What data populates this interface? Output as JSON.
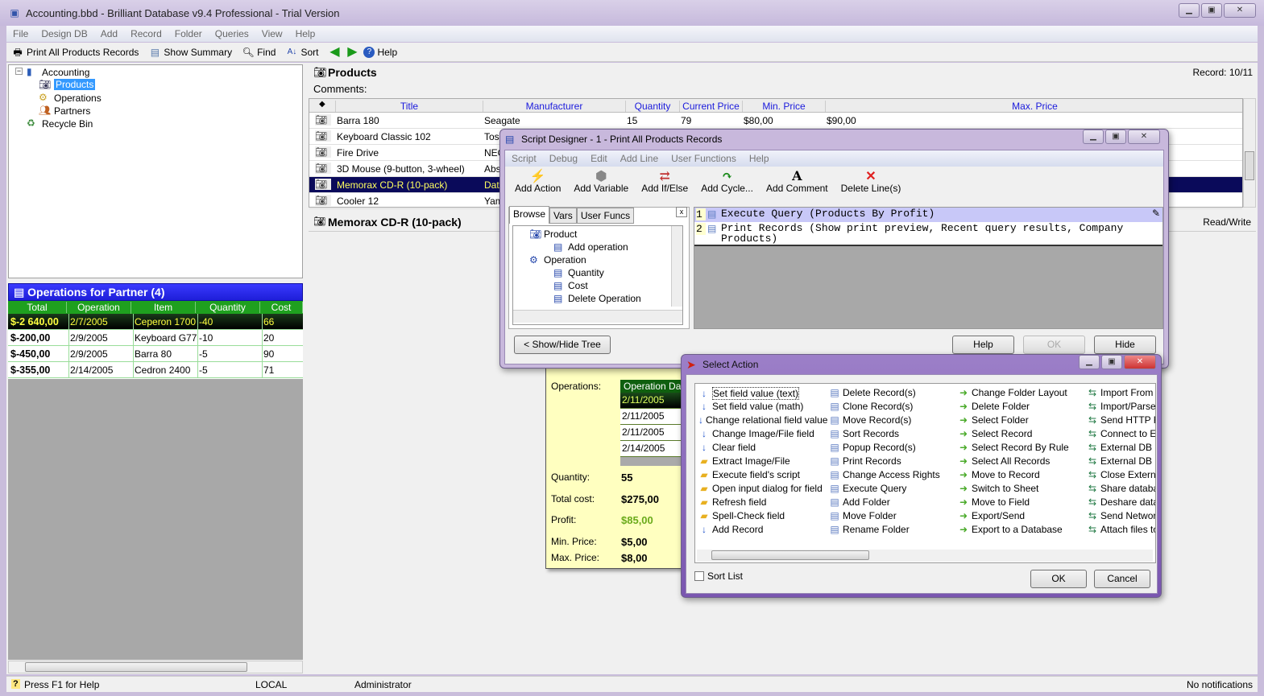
{
  "window": {
    "title": "Accounting.bbd - Brilliant Database v9.4 Professional - Trial Version"
  },
  "menu": [
    "File",
    "Design DB",
    "Add",
    "Record",
    "Folder",
    "Queries",
    "View",
    "Help"
  ],
  "toolbar": {
    "print": "Print All Products Records",
    "summary": "Show Summary",
    "find": "Find",
    "sort": "Sort",
    "help": "Help"
  },
  "tree": {
    "root": "Accounting",
    "items": [
      "Products",
      "Operations",
      "Partners"
    ],
    "recycle": "Recycle Bin"
  },
  "ops": {
    "title": "Operations for Partner (4)",
    "headers": [
      "Total",
      "Operation Date",
      "Item",
      "Quantity",
      "Cost"
    ],
    "rows": [
      [
        "$-2 640,00",
        "2/7/2005",
        "Ceperon 1700",
        "-40",
        "66"
      ],
      [
        "$-200,00",
        "2/9/2005",
        "Keyboard G77",
        "-10",
        "20"
      ],
      [
        "$-450,00",
        "2/9/2005",
        "Barra 80",
        "-5",
        "90"
      ],
      [
        "$-355,00",
        "2/14/2005",
        "Cedron 2400",
        "-5",
        "71"
      ]
    ]
  },
  "products": {
    "title": "Products",
    "comments": "Comments:",
    "record": "Record: 10/11",
    "headers": [
      "Title",
      "Manufacturer",
      "Quantity",
      "Current Price",
      "Min. Price",
      "Max. Price"
    ],
    "rows": [
      [
        "Barra 180",
        "Seagate",
        "15",
        "79",
        "$80,00",
        "$90,00"
      ],
      [
        "Keyboard Classic 102",
        "Tos",
        "",
        "",
        "",
        ""
      ],
      [
        "Fire Drive",
        "NEC",
        "",
        "",
        "",
        ""
      ],
      [
        "3D Mouse (9-button, 3-wheel)",
        "Abs",
        "",
        "",
        "",
        ""
      ],
      [
        "Memorax CD-R (10-pack)",
        "Dat",
        "",
        "",
        "",
        ""
      ],
      [
        "Cooler 12",
        "Yam",
        "",
        "",
        "",
        ""
      ]
    ],
    "selected_index": 4
  },
  "record": {
    "title": "Memorax CD-R (10-pack)",
    "mode": "Read/Write",
    "operations_label": "Operations:",
    "operations_header": "Operation Dat",
    "operations_dates": [
      "2/11/2005",
      "2/11/2005",
      "2/11/2005",
      "2/14/2005"
    ],
    "fields": [
      {
        "label": "Quantity:",
        "value": "55"
      },
      {
        "label": "Total cost:",
        "value": "$275,00"
      },
      {
        "label": "Profit:",
        "value": "$85,00"
      },
      {
        "label": "Min. Price:",
        "value": "$5,00"
      },
      {
        "label": "Max. Price:",
        "value": "$8,00"
      }
    ]
  },
  "script_designer": {
    "title": "Script Designer - 1 - Print All Products Records",
    "menu": [
      "Script",
      "Debug",
      "Edit",
      "Add Line",
      "User Functions",
      "Help"
    ],
    "tools": [
      "Add Action",
      "Add Variable",
      "Add If/Else",
      "Add Cycle...",
      "Add Comment",
      "Delete Line(s)"
    ],
    "tabs": [
      "Browse",
      "Vars",
      "User Funcs"
    ],
    "tree": [
      "Product",
      "Add operation",
      "Operation",
      "Quantity",
      "Cost",
      "Delete Operation"
    ],
    "lines": [
      {
        "n": "1",
        "text": "Execute Query (Products By Profit)"
      },
      {
        "n": "2",
        "text": "Print Records (Show print preview, Recent query results, Company Products)"
      }
    ],
    "show_hide": "< Show/Hide Tree",
    "help": "Help",
    "ok": "OK",
    "hide": "Hide"
  },
  "select_action": {
    "title": "Select Action",
    "columns": [
      [
        "Set field value (text)",
        "Set field value (math)",
        "Change relational field value",
        "Change Image/File field",
        "Clear field",
        "Extract Image/File",
        "Execute field's script",
        "Open input dialog for field",
        "Refresh field",
        "Spell-Check field",
        "Add Record"
      ],
      [
        "Delete Record(s)",
        "Clone Record(s)",
        "Move Record(s)",
        "Sort Records",
        "Popup Record(s)",
        "Print Records",
        "Change Access Rights",
        "Execute Query",
        "Add Folder",
        "Move Folder",
        "Rename Folder"
      ],
      [
        "Change Folder Layout",
        "Delete Folder",
        "Select Folder",
        "Select Record",
        "Select Record By Rule",
        "Select All Records",
        "Move to Record",
        "Switch to Sheet",
        "Move to Field",
        "Export/Send",
        "Export to a Database"
      ],
      [
        "Import From a",
        "Import/Parse",
        "Send HTTP R",
        "Connect to E",
        "External DB C",
        "External DB S",
        "Close Externa",
        "Share databa",
        "Deshare data",
        "Send Networ",
        "Attach files to"
      ]
    ],
    "sort_list": "Sort List",
    "ok": "OK",
    "cancel": "Cancel"
  },
  "status": {
    "help": "Press F1 for Help",
    "mode": "LOCAL",
    "user": "Administrator",
    "notifications": "No notifications"
  }
}
